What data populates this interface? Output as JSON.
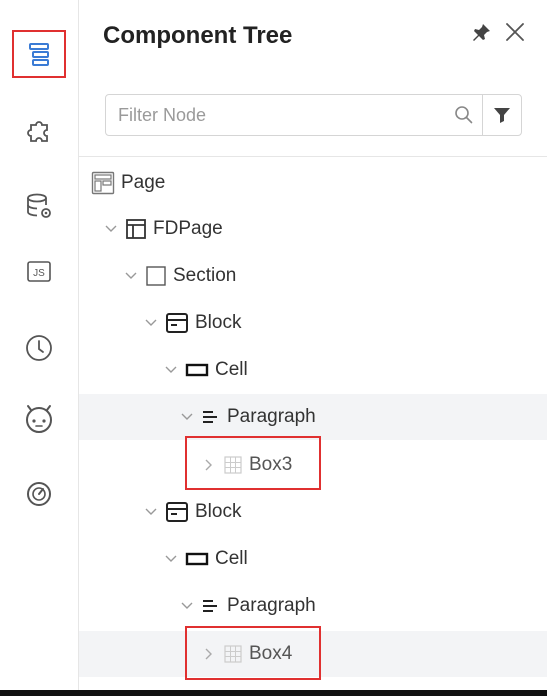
{
  "panel": {
    "title": "Component Tree"
  },
  "filter": {
    "placeholder": "Filter Node",
    "value": ""
  },
  "sidebar": {
    "items": [
      {
        "icon": "component-tree-icon",
        "active": true
      },
      {
        "icon": "puzzle-icon",
        "active": false
      },
      {
        "icon": "datasource-icon",
        "active": false
      },
      {
        "icon": "js-icon",
        "active": false
      },
      {
        "icon": "clock-icon",
        "active": false
      },
      {
        "icon": "robot-icon",
        "active": false
      },
      {
        "icon": "gauge-icon",
        "active": false
      }
    ]
  },
  "tree": {
    "nodes": [
      {
        "label": "Page",
        "icon": "page-icon",
        "depth": 0,
        "expandable": false
      },
      {
        "label": "FDPage",
        "icon": "layout-icon",
        "depth": 1,
        "expandable": true,
        "expanded": true
      },
      {
        "label": "Section",
        "icon": "section-icon",
        "depth": 2,
        "expandable": true,
        "expanded": true
      },
      {
        "label": "Block",
        "icon": "block-icon",
        "depth": 3,
        "expandable": true,
        "expanded": true
      },
      {
        "label": "Cell",
        "icon": "cell-icon",
        "depth": 4,
        "expandable": true,
        "expanded": true
      },
      {
        "label": "Paragraph",
        "icon": "paragraph-icon",
        "depth": 5,
        "expandable": true,
        "expanded": true,
        "highlighted": true
      },
      {
        "label": "Box3",
        "icon": "grid-icon",
        "depth": 6,
        "expandable": true,
        "expanded": false,
        "boxed": true
      },
      {
        "label": "Block",
        "icon": "block-icon",
        "depth": 3,
        "expandable": true,
        "expanded": true
      },
      {
        "label": "Cell",
        "icon": "cell-icon",
        "depth": 4,
        "expandable": true,
        "expanded": true
      },
      {
        "label": "Paragraph",
        "icon": "paragraph-icon",
        "depth": 5,
        "expandable": true,
        "expanded": true
      },
      {
        "label": "Box4",
        "icon": "grid-icon",
        "depth": 6,
        "expandable": true,
        "expanded": false,
        "boxed": true,
        "highlighted": true
      }
    ]
  },
  "colors": {
    "accent": "#3a7bd5",
    "highlight_border": "#e03030",
    "selected_row": "#f3f4f6"
  }
}
